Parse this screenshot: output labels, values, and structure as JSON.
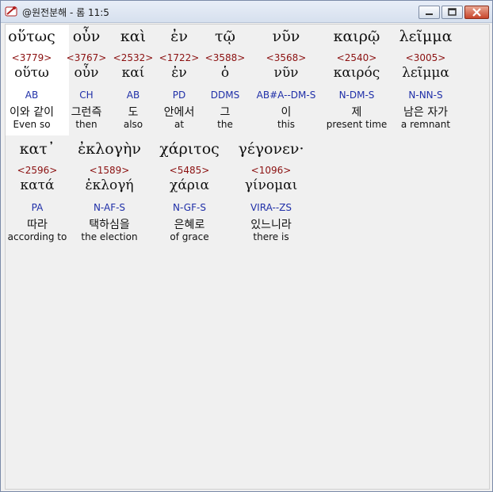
{
  "window": {
    "title": "@원전분해 - 롬 11:5"
  },
  "row1": [
    {
      "greek": "οὕτως",
      "strong": "<3779>",
      "lemma": "οὕτω",
      "parse": "AB",
      "korean": "이와 같이",
      "english": "Even so"
    },
    {
      "greek": "οὖν",
      "strong": "<3767>",
      "lemma": "οὖν",
      "parse": "CH",
      "korean": "그런즉",
      "english": "then"
    },
    {
      "greek": "καὶ",
      "strong": "<2532>",
      "lemma": "καί",
      "parse": "AB",
      "korean": "도",
      "english": "also"
    },
    {
      "greek": "ἐν",
      "strong": "<1722>",
      "lemma": "ἐν",
      "parse": "PD",
      "korean": "안에서",
      "english": "at"
    },
    {
      "greek": "τῷ",
      "strong": "<3588>",
      "lemma": "ὁ",
      "parse": "DDMS",
      "korean": "그",
      "english": "the"
    },
    {
      "greek": "νῦν",
      "strong": "<3568>",
      "lemma": "νῦν",
      "parse": "AB#A--DM-S",
      "korean": "이",
      "english": "this"
    },
    {
      "greek": "καιρῷ",
      "strong": "<2540>",
      "lemma": "καιρός",
      "parse": "N-DM-S",
      "korean": "제",
      "english": "present time"
    },
    {
      "greek": "λεῖμμα",
      "strong": "<3005>",
      "lemma": "λεῖμμα",
      "parse": "N-NN-S",
      "korean": "남은 자가",
      "english": "a remnant"
    }
  ],
  "row2": [
    {
      "greek": "κατ᾽",
      "strong": "<2596>",
      "lemma": "κατά",
      "parse": "PA",
      "korean": "따라",
      "english": "according to"
    },
    {
      "greek": "ἐκλογὴν",
      "strong": "<1589>",
      "lemma": "ἐκλογή",
      "parse": "N-AF-S",
      "korean": "택하심을",
      "english": "the election"
    },
    {
      "greek": "χάριτος",
      "strong": "<5485>",
      "lemma": "χάρια",
      "parse": "N-GF-S",
      "korean": "은혜로",
      "english": "of grace"
    },
    {
      "greek": "γέγονεν·",
      "strong": "<1096>",
      "lemma": "γίνομαι",
      "parse": "VIRA--ZS",
      "korean": "있느니라",
      "english": "there is"
    }
  ]
}
